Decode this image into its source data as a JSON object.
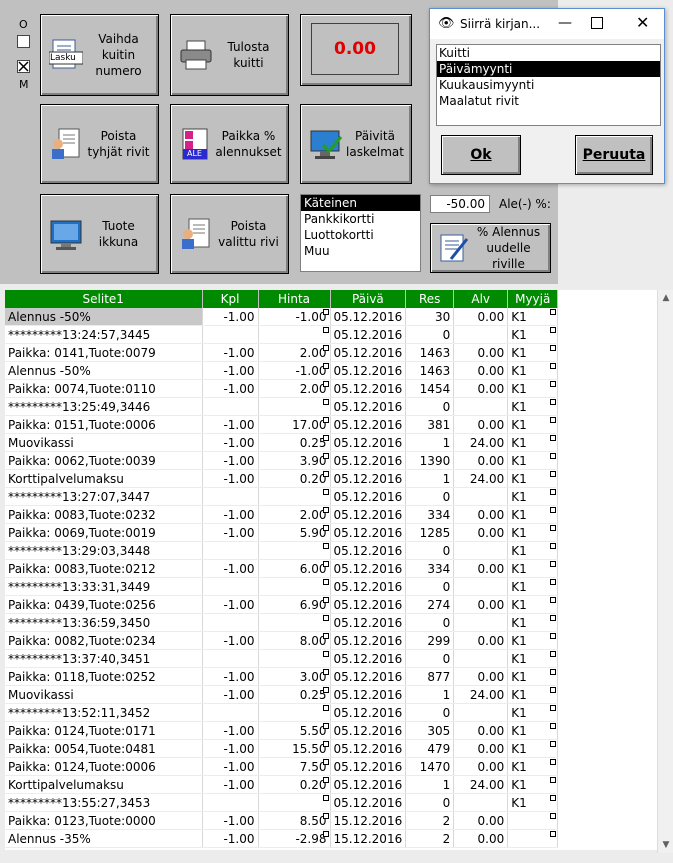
{
  "toolbar": {
    "vaihda": "Vaihda\nkuitin\nnumero",
    "tulosta": "Tulosta\nkuitti",
    "total": "0.00",
    "poista_tyhjat": "Poista\ntyhjät rivit",
    "paikka_alennus": "Paikka %\nalennukset",
    "paivita": "Päivitä\nlaskelmat",
    "tuote_ikkuna": "Tuote\nikkuna",
    "poista_valittu": "Poista\nvalittu rivi",
    "alennus_uudelle": "% Alennus\nuudelle riville",
    "lasku_icon_text": "Lasku",
    "ale_icon_text": "ALE"
  },
  "checkboxes": {
    "o_label": "O",
    "m_label": "M"
  },
  "payment_methods": [
    "Käteinen",
    "Pankkikortti",
    "Luottokortti",
    "Muu"
  ],
  "payment_selected": "Käteinen",
  "discount": {
    "value": "-50.00",
    "label": "Ale(-) %:"
  },
  "dialog": {
    "title": "Siirrä kirjan...",
    "options": [
      "Kuitti",
      "Päivämyynti",
      "Kuukausimyynti",
      "Maalatut rivit"
    ],
    "selected": "Päivämyynti",
    "ok": "Ok",
    "cancel": "Peruuta"
  },
  "table": {
    "columns": [
      "Selite1",
      "Kpl",
      "Hinta",
      "Päivä",
      "Res",
      "Alv",
      "Myyjä"
    ],
    "rows": [
      [
        "Alennus -50%",
        "-1.00",
        "-1.00",
        "05.12.2016",
        "30",
        "0.00",
        "K1"
      ],
      [
        "*********13:24:57,3445",
        "",
        "",
        "05.12.2016",
        "0",
        "",
        "K1"
      ],
      [
        "Paikka: 0141,Tuote:0079",
        "-1.00",
        "2.00",
        "05.12.2016",
        "1463",
        "0.00",
        "K1"
      ],
      [
        "Alennus -50%",
        "-1.00",
        "-1.00",
        "05.12.2016",
        "1463",
        "0.00",
        "K1"
      ],
      [
        "Paikka: 0074,Tuote:0110",
        "-1.00",
        "2.00",
        "05.12.2016",
        "1454",
        "0.00",
        "K1"
      ],
      [
        "*********13:25:49,3446",
        "",
        "",
        "05.12.2016",
        "0",
        "",
        "K1"
      ],
      [
        "Paikka: 0151,Tuote:0006",
        "-1.00",
        "17.00",
        "05.12.2016",
        "381",
        "0.00",
        "K1"
      ],
      [
        "Muovikassi",
        "-1.00",
        "0.25",
        "05.12.2016",
        "1",
        "24.00",
        "K1"
      ],
      [
        "Paikka: 0062,Tuote:0039",
        "-1.00",
        "3.90",
        "05.12.2016",
        "1390",
        "0.00",
        "K1"
      ],
      [
        "Korttipalvelumaksu",
        "-1.00",
        "0.20",
        "05.12.2016",
        "1",
        "24.00",
        "K1"
      ],
      [
        "*********13:27:07,3447",
        "",
        "",
        "05.12.2016",
        "0",
        "",
        "K1"
      ],
      [
        "Paikka: 0083,Tuote:0232",
        "-1.00",
        "2.00",
        "05.12.2016",
        "334",
        "0.00",
        "K1"
      ],
      [
        "Paikka: 0069,Tuote:0019",
        "-1.00",
        "5.90",
        "05.12.2016",
        "1285",
        "0.00",
        "K1"
      ],
      [
        "*********13:29:03,3448",
        "",
        "",
        "05.12.2016",
        "0",
        "",
        "K1"
      ],
      [
        "Paikka: 0083,Tuote:0212",
        "-1.00",
        "6.00",
        "05.12.2016",
        "334",
        "0.00",
        "K1"
      ],
      [
        "*********13:33:31,3449",
        "",
        "",
        "05.12.2016",
        "0",
        "",
        "K1"
      ],
      [
        "Paikka: 0439,Tuote:0256",
        "-1.00",
        "6.90",
        "05.12.2016",
        "274",
        "0.00",
        "K1"
      ],
      [
        "*********13:36:59,3450",
        "",
        "",
        "05.12.2016",
        "0",
        "",
        "K1"
      ],
      [
        "Paikka: 0082,Tuote:0234",
        "-1.00",
        "8.00",
        "05.12.2016",
        "299",
        "0.00",
        "K1"
      ],
      [
        "*********13:37:40,3451",
        "",
        "",
        "05.12.2016",
        "0",
        "",
        "K1"
      ],
      [
        "Paikka: 0118,Tuote:0252",
        "-1.00",
        "3.00",
        "05.12.2016",
        "877",
        "0.00",
        "K1"
      ],
      [
        "Muovikassi",
        "-1.00",
        "0.25",
        "05.12.2016",
        "1",
        "24.00",
        "K1"
      ],
      [
        "*********13:52:11,3452",
        "",
        "",
        "05.12.2016",
        "0",
        "",
        "K1"
      ],
      [
        "Paikka: 0124,Tuote:0171",
        "-1.00",
        "5.50",
        "05.12.2016",
        "305",
        "0.00",
        "K1"
      ],
      [
        "Paikka: 0054,Tuote:0481",
        "-1.00",
        "15.50",
        "05.12.2016",
        "479",
        "0.00",
        "K1"
      ],
      [
        "Paikka: 0124,Tuote:0006",
        "-1.00",
        "7.50",
        "05.12.2016",
        "1470",
        "0.00",
        "K1"
      ],
      [
        "Korttipalvelumaksu",
        "-1.00",
        "0.20",
        "05.12.2016",
        "1",
        "24.00",
        "K1"
      ],
      [
        "*********13:55:27,3453",
        "",
        "",
        "05.12.2016",
        "0",
        "",
        "K1"
      ],
      [
        "Paikka: 0123,Tuote:0000",
        "-1.00",
        "8.50",
        "15.12.2016",
        "2",
        "0.00",
        ""
      ],
      [
        "Alennus -35%",
        "-1.00",
        "-2.98",
        "15.12.2016",
        "2",
        "0.00",
        ""
      ]
    ]
  },
  "colors": {
    "header_green": "#008a00",
    "total_red": "#e00000",
    "panel_gray": "#c0c0c0"
  }
}
